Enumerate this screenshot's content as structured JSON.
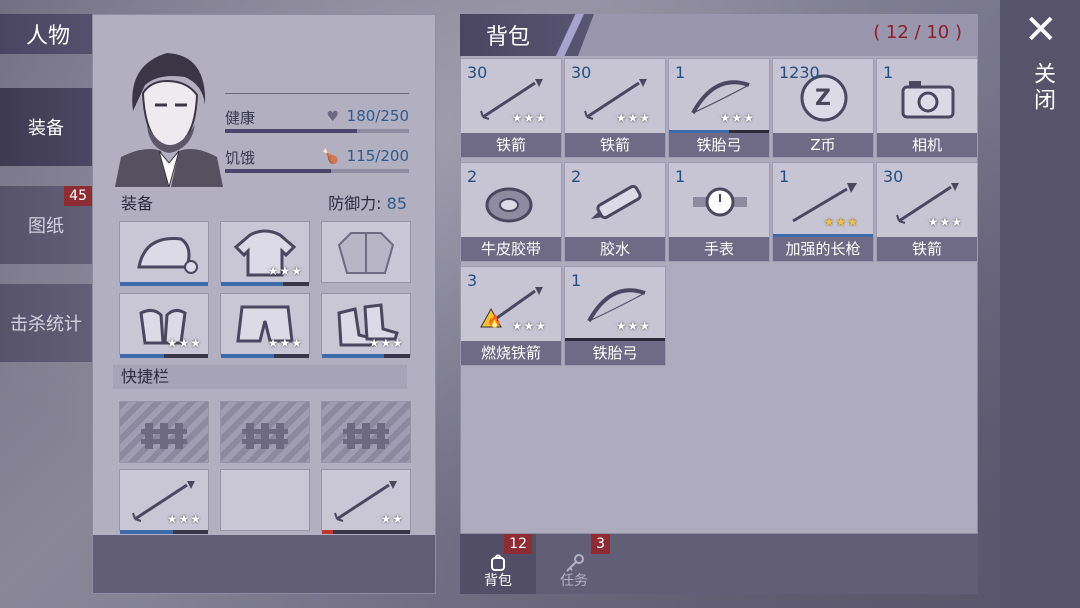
{
  "character": {
    "title": "人物",
    "tabs": [
      {
        "label": "装备",
        "active": true
      },
      {
        "label": "图纸",
        "badge": "45"
      },
      {
        "label": "击杀统计"
      }
    ],
    "stats": {
      "health_label": "健康",
      "health_value": "180/250",
      "health_fraction": 0.72,
      "hunger_label": "饥饿",
      "hunger_value": "115/200",
      "hunger_fraction": 0.575
    },
    "equipment_label": "装备",
    "defense_label": "防御力:",
    "defense_value": "85",
    "equipment_slots": [
      {
        "icon": "beanie-hat-icon",
        "stars": "",
        "durability": 1.0
      },
      {
        "icon": "hoodie-icon",
        "stars": "★★★",
        "durability": 0.7
      },
      {
        "icon": "jacket-icon",
        "stars": "",
        "durability": null
      },
      {
        "icon": "gloves-icon",
        "stars": "★★★",
        "durability": 0.5
      },
      {
        "icon": "shorts-icon",
        "stars": "★★★",
        "durability": 0.6
      },
      {
        "icon": "boots-icon",
        "stars": "★★★",
        "durability": 0.7
      }
    ],
    "quickbar_label": "快捷栏",
    "quickbar_slots": [
      {
        "locked": true,
        "icon": "fence-icon"
      },
      {
        "locked": true,
        "icon": "fence-icon"
      },
      {
        "locked": true,
        "icon": "fence-icon"
      },
      {
        "icon": "arrow-icon",
        "stars": "★★★",
        "durability": 0.6
      },
      {
        "icon": "",
        "stars": ""
      },
      {
        "icon": "arrow-icon",
        "stars": "★★",
        "durability": 0.12
      }
    ]
  },
  "backpack": {
    "title": "背包",
    "capacity": "( 12 / 10 )",
    "items": [
      {
        "qty": "30",
        "name": "铁箭",
        "icon": "arrow-icon",
        "stars": "★★★",
        "gold": false
      },
      {
        "qty": "30",
        "name": "铁箭",
        "icon": "arrow-icon",
        "stars": "★★★",
        "gold": false
      },
      {
        "qty": "1",
        "name": "铁胎弓",
        "icon": "bow-icon",
        "stars": "★★★",
        "gold": false,
        "durability": 0.6
      },
      {
        "qty": "1230",
        "name": "Z币",
        "icon": "z-coin-icon",
        "stars": "",
        "gold": false
      },
      {
        "qty": "1",
        "name": "相机",
        "icon": "camera-icon",
        "stars": "",
        "gold": false
      },
      {
        "qty": "2",
        "name": "牛皮胶带",
        "icon": "duct-tape-icon",
        "stars": "",
        "gold": false
      },
      {
        "qty": "2",
        "name": "胶水",
        "icon": "glue-icon",
        "stars": "",
        "gold": false
      },
      {
        "qty": "1",
        "name": "手表",
        "icon": "watch-icon",
        "stars": "",
        "gold": false
      },
      {
        "qty": "1",
        "name": "加强的长枪",
        "icon": "spear-icon",
        "stars": "★★★",
        "gold": true,
        "durability": 1.0
      },
      {
        "qty": "30",
        "name": "铁箭",
        "icon": "arrow-icon",
        "stars": "★★★",
        "gold": false
      },
      {
        "qty": "3",
        "name": "燃烧铁箭",
        "icon": "fire-arrow-icon",
        "stars": "★★★",
        "gold": false
      },
      {
        "qty": "1",
        "name": "铁胎弓",
        "icon": "bow-icon",
        "stars": "★★★",
        "gold": false,
        "durability": 0.0
      }
    ]
  },
  "bottom_tabs": [
    {
      "label": "背包",
      "badge": "12",
      "icon": "backpack-icon",
      "active": true
    },
    {
      "label": "任务",
      "badge": "3",
      "icon": "key-icon",
      "active": false
    }
  ],
  "close": {
    "label": "关闭",
    "icon": "close-icon"
  }
}
